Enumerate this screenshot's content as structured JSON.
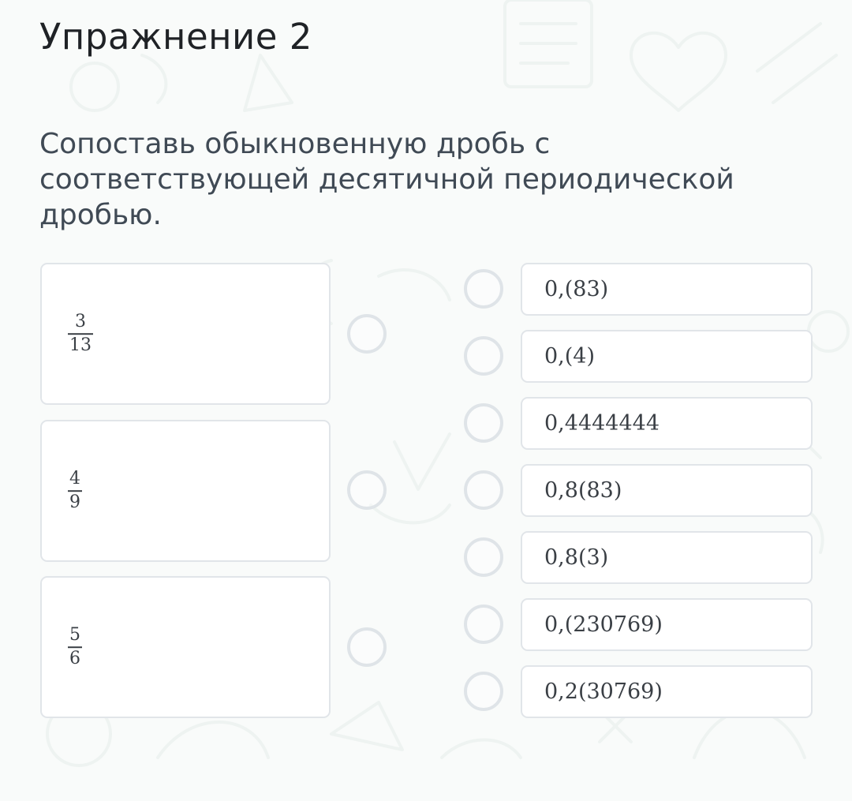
{
  "exercise": {
    "title": "Упражнение 2",
    "instruction": "Сопоставь обыкновенную дробь с соответствующей десятичной периодической дробью."
  },
  "fractions": [
    {
      "numerator": "3",
      "denominator": "13"
    },
    {
      "numerator": "4",
      "denominator": "9"
    },
    {
      "numerator": "5",
      "denominator": "6"
    }
  ],
  "decimals": [
    "0,(83)",
    "0,(4)",
    "0,4444444",
    "0,8(83)",
    "0,8(3)",
    "0,(230769)",
    "0,2(30769)"
  ],
  "colors": {
    "card_border": "#e1e5e9",
    "connector_dot": "#dfe4e8",
    "text": "#3a3f45",
    "background": "#f9fbfa"
  }
}
